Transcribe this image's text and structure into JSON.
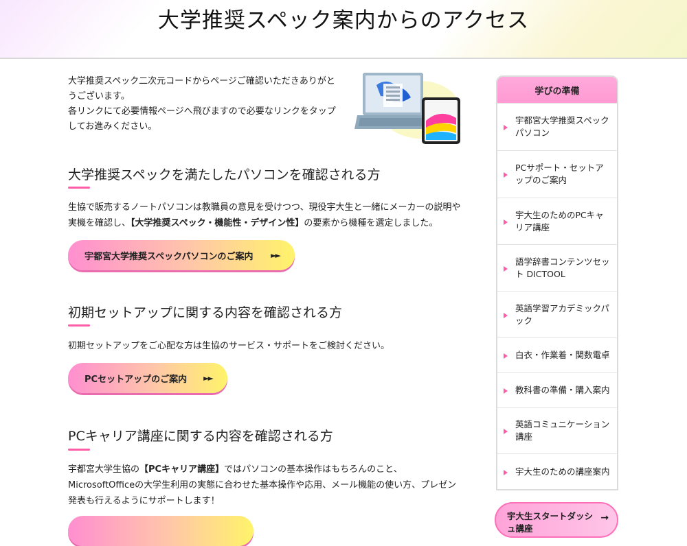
{
  "header": {
    "title": "大学推奨スペック案内からのアクセス"
  },
  "intro": {
    "line1": "大学推奨スペック二次元コードからページご確認いただきありがとうございます。",
    "line2": "各リンクにて必要情報ページへ飛びますので必要なリンクをタップしてお進みください。"
  },
  "sections": [
    {
      "heading": "大学推奨スペックを満たしたパソコンを確認される方",
      "body_pre": "生協で販売するノートパソコンは教職員の意見を受けつつ、現役宇大生と一緒にメーカーの説明や実機を確認し、",
      "body_strong": "【大学推奨スペック・機能性・デザイン性】",
      "body_post": "の要素から機種を選定しました。",
      "button": "宇都宮大学推奨スペックパソコンのご案内",
      "arrows": "►►"
    },
    {
      "heading": "初期セットアップに関する内容を確認される方",
      "body": "初期セットアップをご心配な方は生協のサービス・サポートをご検討ください。",
      "button": "PCセットアップのご案内",
      "arrows": "►►"
    },
    {
      "heading": "PCキャリア講座に関する内容を確認される方",
      "body_pre": "宇都宮大学生協の",
      "body_strong": "【PCキャリア講座】",
      "body_post": "ではパソコンの基本操作はもちろんのこと、MicrosoftOfficeの大学生利用の実態に合わせた基本操作や応用、メール機能の使い方、プレゼン発表も行えるようにサポートします！"
    }
  ],
  "sidebar": {
    "title": "学びの準備",
    "items": [
      {
        "label": "宇都宮大学推奨スペックパソコン"
      },
      {
        "label": "PCサポート・セットアップのご案内"
      },
      {
        "label": "宇大生のためのPCキャリア講座"
      },
      {
        "label": "語学辞書コンテンツセット DICTOOL"
      },
      {
        "label": "英語学習アカデミックパック"
      },
      {
        "label": "白衣・作業着・関数電卓"
      },
      {
        "label": "教科書の準備・購入案内"
      },
      {
        "label": "英語コミュニケーション講座"
      },
      {
        "label": "宇大生のための講座案内"
      }
    ],
    "start_button": "宇大生スタートダッシュ講座",
    "start_arrow": "→"
  },
  "colors": {
    "accent_pink": "#ff5ca8",
    "sidebar_head": "#ff9ad3",
    "button_gradient_start": "#ff8fd0",
    "button_gradient_end": "#fff36a"
  }
}
